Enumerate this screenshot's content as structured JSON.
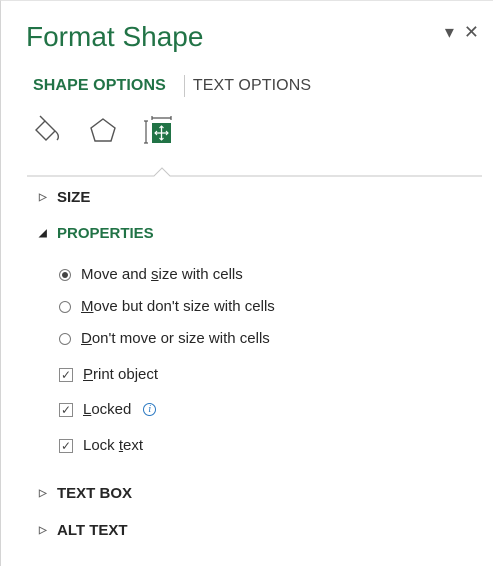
{
  "pane": {
    "title": "Format Shape",
    "controls": {
      "dropdown_icon": "chevron-down-icon",
      "close_icon": "close-icon",
      "dropdown_glyph": "▾",
      "close_glyph": "✕"
    }
  },
  "tabs": [
    {
      "label": "SHAPE OPTIONS",
      "active": true
    },
    {
      "label": "TEXT OPTIONS",
      "active": false
    }
  ],
  "option_icons": [
    {
      "name": "fill-line-icon",
      "selected": false
    },
    {
      "name": "effects-icon",
      "selected": false
    },
    {
      "name": "size-properties-icon",
      "selected": true
    }
  ],
  "sections": {
    "size": {
      "label": "SIZE",
      "expanded": false
    },
    "properties": {
      "label": "PROPERTIES",
      "expanded": true
    },
    "text_box": {
      "label": "TEXT BOX",
      "expanded": false
    },
    "alt_text": {
      "label": "ALT TEXT",
      "expanded": false
    }
  },
  "properties": {
    "radios": [
      {
        "pre": "Move and ",
        "accel": "s",
        "post": "ize with cells",
        "checked": true
      },
      {
        "pre": "",
        "accel": "M",
        "post": "ove but don't size with cells",
        "checked": false
      },
      {
        "pre": "",
        "accel": "D",
        "post": "on't move or size with cells",
        "checked": false
      }
    ],
    "checks": [
      {
        "pre": "",
        "accel": "P",
        "post": "rint object",
        "checked": true,
        "info": false
      },
      {
        "pre": "",
        "accel": "L",
        "post": "ocked",
        "checked": true,
        "info": true
      },
      {
        "pre": "Lock ",
        "accel": "t",
        "post": "ext",
        "checked": true,
        "info": false
      }
    ]
  },
  "colors": {
    "accent": "#217346",
    "info": "#2b79c2"
  }
}
